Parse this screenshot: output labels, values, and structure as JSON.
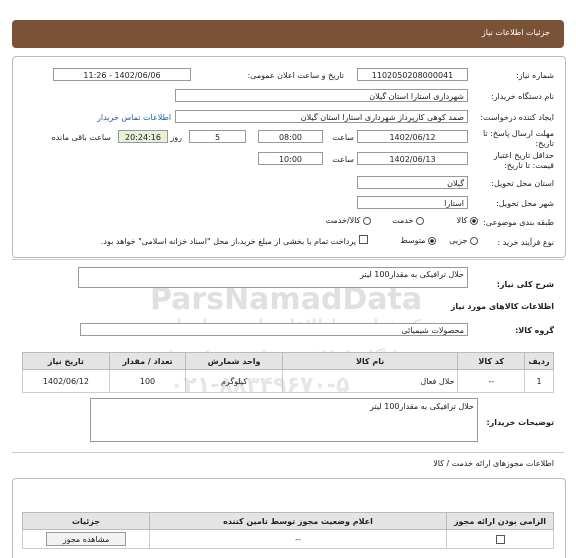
{
  "header": {
    "title": "جزئیات اطلاعات نیاز"
  },
  "form": {
    "need_number_label": "شماره نیاز:",
    "need_number": "1102050208000041",
    "announce_label": "تاریخ و ساعت اعلان عمومی:",
    "announce_value": "1402/06/06 - 11:26",
    "buyer_org_label": "نام دستگاه خریدار:",
    "buyer_org": "شهرداری استارا استان گیلان",
    "creator_label": "ایجاد کننده درخواست:",
    "creator": "صمد کوهی کارپرداز شهرداری استارا استان گیلان",
    "contact_link": "اطلاعات تماس خریدار",
    "deadline_label_1": "مهلت ارسال پاسخ: تا",
    "deadline_label_2": "تاریخ:",
    "deadline_date": "1402/06/12",
    "hour_label": "ساعت",
    "deadline_time": "08:00",
    "days_value": "5",
    "days_label": "روز و",
    "remaining_time": "20:24:16",
    "remaining_label": "ساعت باقی مانده",
    "min_validity_label_1": "حداقل تاریخ اعتبار",
    "min_validity_label_2": "قیمت: تا تاریخ:",
    "validity_date": "1402/06/13",
    "validity_hour_label": "ساعت",
    "validity_time": "10:00",
    "province_label": "استان محل تحویل:",
    "province": "گیلان",
    "city_label": "شهر محل تحویل:",
    "city": "استارا",
    "category_label": "طبقه بندی موضوعی:",
    "category_options": [
      "کالا",
      "خدمت",
      "کالا/خدمت"
    ],
    "process_label": "نوع فرآیند خرید :",
    "process_options": [
      "جزیی",
      "متوسط"
    ],
    "payment_note": "پرداخت تمام یا بخشی از مبلغ خرید،از محل \"اسناد خزانه اسلامی\" خواهد بود."
  },
  "summary": {
    "label": "شرح کلی نیاز:",
    "value": "حلال ترافیکی به مقدار100 لیتر"
  },
  "goods_section_title": "اطلاعات کالاهای مورد نیاز",
  "goods_group": {
    "label": "گروه کالا:",
    "value": "محصولات شیمیائی"
  },
  "items_table": {
    "headers": [
      "ردیف",
      "کد کالا",
      "نام کالا",
      "واحد شمارش",
      "تعداد / مقدار",
      "تاریخ نیاز"
    ],
    "rows": [
      [
        "1",
        "--",
        "حلال فعال",
        "کیلوگرم",
        "100",
        "1402/06/12"
      ]
    ]
  },
  "buyer_notes": {
    "label": "توضیحات خریدار:",
    "value": "حلال ترافیکی به مقدار100 لیتر"
  },
  "services_section_title": "اطلاعات مجوزهای ارائه خدمت / کالا",
  "permits_table": {
    "headers": [
      "الزامی بودن ارائه مجوز",
      "اعلام وضعیت مجوز توسط تامین کننده",
      "جزئیات"
    ],
    "row_status": "--",
    "view_button": "مشاهده مجوز"
  },
  "watermark": {
    "brand": "ParsNamadData",
    "line_fa_1": "مرکز فراوری اطلاعات پارس نماد داده",
    "line_fa_2": "پایگاه اطلاع رسانی مناقصات",
    "phone": "۰۲۱-۸۸۳۴۹۶۷۰-۵",
    "year": "1401"
  }
}
